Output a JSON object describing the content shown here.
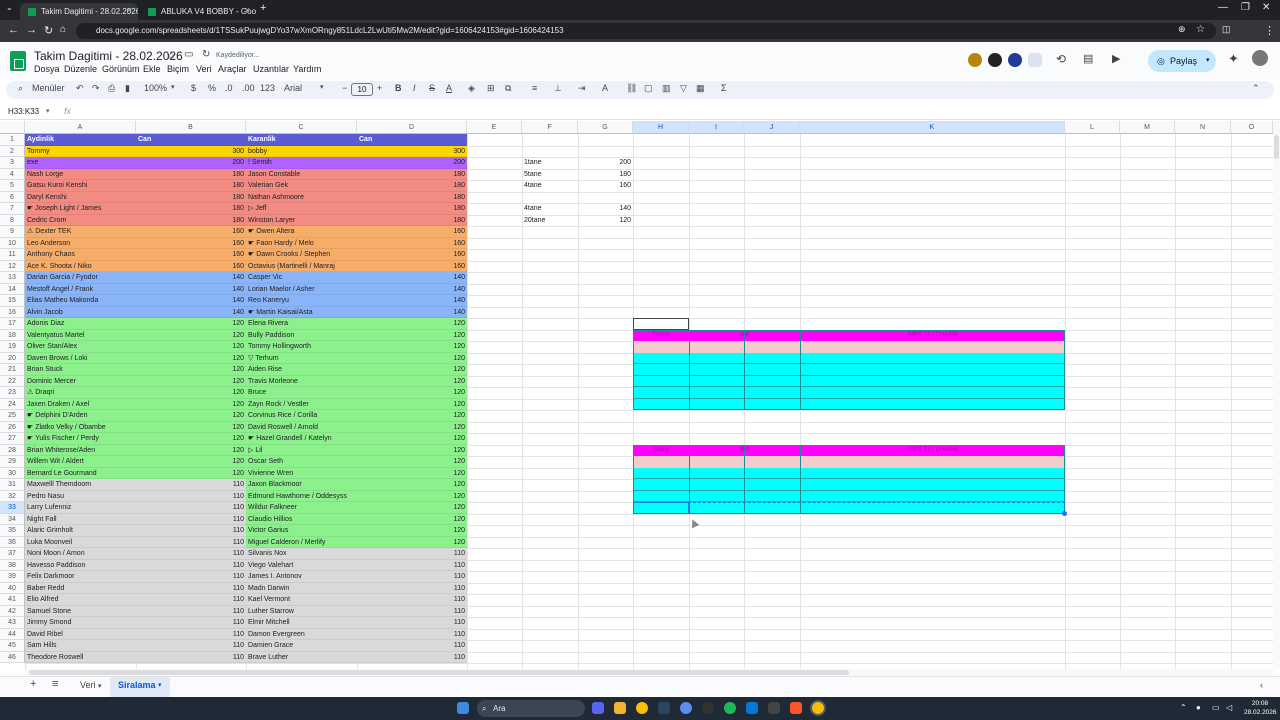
{
  "browser": {
    "tabs": [
      {
        "title": "Takim Dagitimi - 28.02.2026 - G"
      },
      {
        "title": "ABLUKA V4 BOBBY - Google S"
      }
    ],
    "url": "docs.google.com/spreadsheets/d/1TSSukPuujwgDYo37wXmORngy851LdcL2LwUti5Mw2M/edit?gid=1606424153#gid=1606424153"
  },
  "doc": {
    "title": "Takim Dagitimi - 28.02.2026",
    "save_status": "Kaydediliyor...",
    "menus": [
      "Dosya",
      "Düzenle",
      "Görünüm",
      "Ekle",
      "Biçim",
      "Veri",
      "Araçlar",
      "Uzantılar",
      "Yardım"
    ],
    "share_label": "Paylaş"
  },
  "toolbar": {
    "menus_label": "Menüler",
    "zoom": "100%",
    "currency": "$",
    "percent": "%",
    "dec_minus": ".0",
    "dec_plus": ".00",
    "format123": "123",
    "font": "Arial",
    "font_size": "10"
  },
  "formula_bar": {
    "name_box": "H33:K33",
    "fx": "fx",
    "content": ""
  },
  "columns": [
    "A",
    "B",
    "C",
    "D",
    "E",
    "F",
    "G",
    "H",
    "I",
    "J",
    "K",
    "L",
    "M",
    "N",
    "O"
  ],
  "headers": {
    "a": "Aydinlik",
    "b": "Can",
    "c": "Karanlik",
    "d": "Can"
  },
  "rows": [
    {
      "a": "Tommy",
      "b": "300",
      "c": "bobby",
      "d": "300",
      "color": "#ffd600"
    },
    {
      "a": "exe",
      "b": "200",
      "c": "! Semih",
      "d": "200",
      "color": "#b061ff"
    },
    {
      "a": "Nash Lorge",
      "b": "180",
      "c": "Jason Constable",
      "d": "180",
      "color": "#f28b82"
    },
    {
      "a": "Gatsu Kuroi Kenshi",
      "b": "180",
      "c": "Valerian Gek",
      "d": "180",
      "color": "#f28b82"
    },
    {
      "a": "Daryl Kenshi",
      "b": "180",
      "c": "Nathan Ashmoore",
      "d": "180",
      "color": "#f28b82"
    },
    {
      "a": "☛ Joseph Light / James",
      "b": "180",
      "c": "▷ Jeff",
      "d": "180",
      "color": "#f28b82"
    },
    {
      "a": "Cedric Crom",
      "b": "180",
      "c": "Winston Laryer",
      "d": "180",
      "color": "#f28b82"
    },
    {
      "a": "⚠ Dexter TEK",
      "b": "160",
      "c": "☛ Owen Altera",
      "d": "160",
      "color": "#f6ad6a"
    },
    {
      "a": "Leo Anderson",
      "b": "160",
      "c": "☛ Faon Hardy / Melo",
      "d": "160",
      "color": "#f6ad6a"
    },
    {
      "a": "Anthony Chaos",
      "b": "160",
      "c": "☛ Dawn Crooks / Stephen",
      "d": "160",
      "color": "#f6ad6a"
    },
    {
      "a": "Ace K. Shoota / Niko",
      "b": "160",
      "c": "Octavius (Martinelli / Manraj",
      "d": "160",
      "color": "#f6ad6a"
    },
    {
      "a": "Darian Garcia / Fyodor",
      "b": "140",
      "c": "Casper Vic",
      "d": "140",
      "color": "#8ab4f8"
    },
    {
      "a": "Mestoff Angel / Frank",
      "b": "140",
      "c": "Lorian Maelor / Asher",
      "d": "140",
      "color": "#8ab4f8"
    },
    {
      "a": "Elias Matheu Makonda",
      "b": "140",
      "c": "Reo Kaneryu",
      "d": "140",
      "color": "#8ab4f8"
    },
    {
      "a": "Alvin Jacob",
      "b": "140",
      "c": "☛ Martin Kaisai/Asta",
      "d": "140",
      "color": "#8ab4f8"
    },
    {
      "a": "Adonis Diaz",
      "b": "120",
      "c": "Elena Rivera",
      "d": "120",
      "color": "#8cf08c"
    },
    {
      "a": "Valentyatus Martel",
      "b": "120",
      "c": "Bully Paddison",
      "d": "120",
      "color": "#8cf08c"
    },
    {
      "a": "Oliver Stan/Alex",
      "b": "120",
      "c": "Tommy Hollingworth",
      "d": "120",
      "color": "#8cf08c"
    },
    {
      "a": "Daven Brows / Loki",
      "b": "120",
      "c": "▽ Terhum",
      "d": "120",
      "color": "#8cf08c"
    },
    {
      "a": "Brian Stuck",
      "b": "120",
      "c": "Aiden Rise",
      "d": "120",
      "color": "#8cf08c"
    },
    {
      "a": "Dominic Mercer",
      "b": "120",
      "c": "Travis Morleone",
      "d": "120",
      "color": "#8cf08c"
    },
    {
      "a": "⚠ Draqri",
      "b": "120",
      "c": "Bruce",
      "d": "120",
      "color": "#8cf08c"
    },
    {
      "a": "Jaxen Draken / Axel",
      "b": "120",
      "c": "Zayn Rock / Vestler",
      "d": "120",
      "color": "#8cf08c"
    },
    {
      "a": "☛ Delphini D'Arden",
      "b": "120",
      "c": "Corvinus Rice / Corilla",
      "d": "120",
      "color": "#8cf08c"
    },
    {
      "a": "☛ Zlatko Velky / Obambe",
      "b": "120",
      "c": "David Roswell / Arnold",
      "d": "120",
      "color": "#8cf08c"
    },
    {
      "a": "☛ Yulis Fischer / Perdy",
      "b": "120",
      "c": "☛ Hazel Grandell / Katelyn",
      "d": "120",
      "color": "#8cf08c"
    },
    {
      "a": "Brian Whiterose/Aden",
      "b": "120",
      "c": "▷ Lil",
      "d": "120",
      "color": "#8cf08c"
    },
    {
      "a": "Willem Wit / Aldert",
      "b": "120",
      "c": "Oscar Seth",
      "d": "120",
      "color": "#8cf08c"
    },
    {
      "a": "Bernard Le Gourmand",
      "b": "120",
      "c": "Vivienne Wren",
      "d": "120",
      "color": "#8cf08c"
    },
    {
      "a": "Maxwelll Themdoom",
      "b": "110",
      "c": "Jaxon Blackmoor",
      "d": "120",
      "color": "#d9d9d9",
      "colorR": "#8cf08c"
    },
    {
      "a": "Pedro Nasu",
      "b": "110",
      "c": "Edmund Hawthorne / Oddesyss",
      "d": "120",
      "color": "#d9d9d9",
      "colorR": "#8cf08c"
    },
    {
      "a": "Larry Lufenniz",
      "b": "110",
      "c": "Wildur Falkneer",
      "d": "120",
      "color": "#d9d9d9",
      "colorR": "#8cf08c"
    },
    {
      "a": "Night Fall",
      "b": "110",
      "c": "Claudio Hillios",
      "d": "120",
      "color": "#d9d9d9",
      "colorR": "#8cf08c"
    },
    {
      "a": "Alaric Grimholt",
      "b": "110",
      "c": "Victor Garius",
      "d": "120",
      "color": "#d9d9d9",
      "colorR": "#8cf08c"
    },
    {
      "a": "Luka Moonveil",
      "b": "110",
      "c": "Miguel Calderon / Merlify",
      "d": "120",
      "color": "#d9d9d9",
      "colorR": "#8cf08c"
    },
    {
      "a": "Noni Moon / Amon",
      "b": "110",
      "c": "Silvanis Nox",
      "d": "110",
      "color": "#d9d9d9"
    },
    {
      "a": "Havesso Paddison",
      "b": "110",
      "c": "Viego Valehart",
      "d": "110",
      "color": "#d9d9d9"
    },
    {
      "a": "Felix Darkmoor",
      "b": "110",
      "c": "James I. Antonov",
      "d": "110",
      "color": "#d9d9d9"
    },
    {
      "a": "Baber Redd",
      "b": "110",
      "c": "Madn Darwin",
      "d": "110",
      "color": "#d9d9d9"
    },
    {
      "a": "Elio Alfred",
      "b": "110",
      "c": "Kael Vermont",
      "d": "110",
      "color": "#d9d9d9"
    },
    {
      "a": "Samuel Stone",
      "b": "110",
      "c": "Luther Starrow",
      "d": "110",
      "color": "#d9d9d9"
    },
    {
      "a": "Jimmy Smond",
      "b": "110",
      "c": "Elmir Mitchell",
      "d": "110",
      "color": "#d9d9d9"
    },
    {
      "a": "David Ribel",
      "b": "110",
      "c": "Damon Evergreen",
      "d": "110",
      "color": "#d9d9d9"
    },
    {
      "a": "Sam Hills",
      "b": "110",
      "c": "Damien Grace",
      "d": "110",
      "color": "#d9d9d9"
    },
    {
      "a": "Theodore Roswell",
      "b": "110",
      "c": "Brave Luther",
      "d": "110",
      "color": "#d9d9d9"
    }
  ],
  "summary": [
    {
      "label": "1tane",
      "value": "200"
    },
    {
      "label": "5tane",
      "value": "180"
    },
    {
      "label": "4tane",
      "value": "160"
    },
    {
      "label": "",
      "value": ""
    },
    {
      "label": "4tane",
      "value": "140"
    },
    {
      "label": "20tane",
      "value": "120"
    }
  ],
  "boxes": [
    {
      "left": "Tommy",
      "mid": "300",
      "right": "IMPS T2 / CHAIN6"
    },
    {
      "left": "bobby",
      "mid": "300",
      "right": "IMPS T2 / CHAIN6"
    }
  ],
  "row_numbers": [
    "1",
    "2",
    "3",
    "4",
    "5",
    "6",
    "7",
    "8",
    "9",
    "10",
    "11",
    "12",
    "13",
    "14",
    "15",
    "16",
    "17",
    "18",
    "19",
    "20",
    "21",
    "22",
    "23",
    "24",
    "25",
    "26",
    "27",
    "28",
    "29",
    "30",
    "31",
    "32",
    "33",
    "34",
    "35",
    "36",
    "37",
    "38",
    "39",
    "40",
    "41",
    "42",
    "43",
    "44",
    "45",
    "46"
  ],
  "sheet_tabs": {
    "add": "+",
    "list": "≡",
    "tabs": [
      {
        "label": "Veri"
      },
      {
        "label": "Siralama"
      }
    ]
  },
  "taskbar": {
    "search": "Ara",
    "time": "20:08",
    "date": "28.02.2026"
  },
  "colors": {
    "selection": "#d3e3fd",
    "accent": "#0b57d0",
    "cyan": "#00ffff",
    "magenta": "#ff00ff",
    "pink": "#f4cccc"
  }
}
